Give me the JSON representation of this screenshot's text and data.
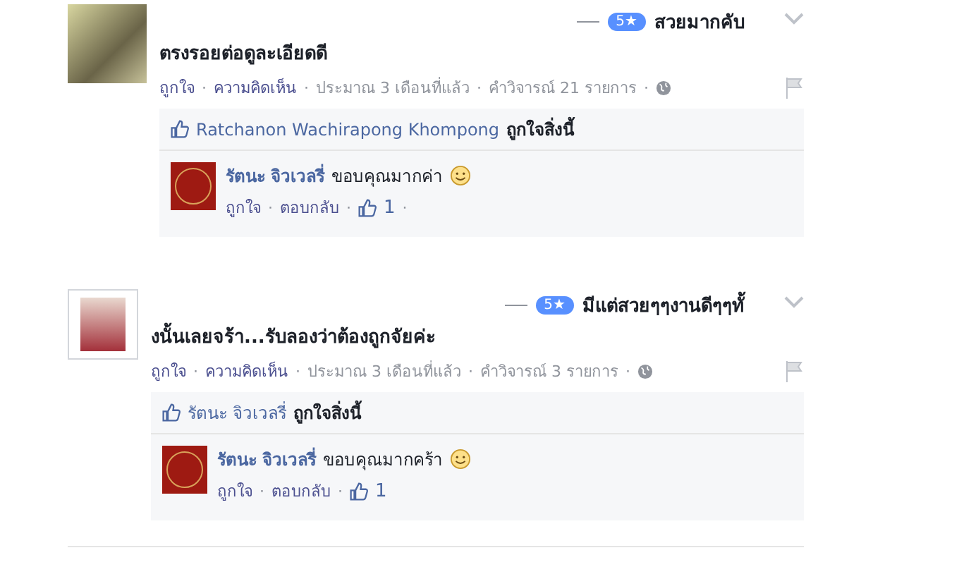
{
  "reviews": [
    {
      "avatar_framed": false,
      "rating": "5★",
      "text_line_1": "สวยมากคับ",
      "text_line_2": "ตรงรอยต่อดูละเอียดดี",
      "meta": [
        {
          "kind": "link",
          "text": "ถูกใจ"
        },
        {
          "kind": "dot",
          "text": "·"
        },
        {
          "kind": "link",
          "text": "ความคิดเห็น"
        },
        {
          "kind": "dot",
          "text": "·"
        },
        {
          "kind": "plain",
          "text": "ประมาณ 3 เดือนที่แล้ว"
        },
        {
          "kind": "dot",
          "text": "·"
        },
        {
          "kind": "plain",
          "text": "คำวิจารณ์ 21 รายการ"
        },
        {
          "kind": "dot",
          "text": "·"
        }
      ],
      "likes": {
        "name": "Ratchanon Wachirapong Khompong",
        "suffix": "ถูกใจสิ่งนี้"
      },
      "reply": {
        "name": "รัตนะ จิวเวลรี่",
        "text": "ขอบคุณมากค่า",
        "actions": [
          {
            "kind": "link",
            "text": "ถูกใจ"
          },
          {
            "kind": "dot",
            "text": "·"
          },
          {
            "kind": "link",
            "text": "ตอบกลับ"
          },
          {
            "kind": "dot",
            "text": "·"
          },
          {
            "kind": "likes",
            "text": "1"
          },
          {
            "kind": "dot",
            "text": "·"
          }
        ]
      }
    },
    {
      "avatar_framed": true,
      "rating": "5★",
      "text_line_1": "มีแต่สวยๆๆงานดีๆๆทั้",
      "text_line_2": "งนั้นเลยจร้า...รับลองว่าต้องถูกจัยค่ะ",
      "meta": [
        {
          "kind": "link",
          "text": "ถูกใจ"
        },
        {
          "kind": "dot",
          "text": "·"
        },
        {
          "kind": "link",
          "text": "ความคิดเห็น"
        },
        {
          "kind": "dot",
          "text": "·"
        },
        {
          "kind": "plain",
          "text": "ประมาณ 3 เดือนที่แล้ว"
        },
        {
          "kind": "dot",
          "text": "·"
        },
        {
          "kind": "plain",
          "text": "คำวิจารณ์ 3 รายการ"
        },
        {
          "kind": "dot",
          "text": "·"
        }
      ],
      "likes": {
        "name": "รัตนะ จิวเวลรี่",
        "suffix": "ถูกใจสิ่งนี้"
      },
      "reply": {
        "name": "รัตนะ จิวเวลรี่",
        "text": "ขอบคุณมากคร้า",
        "actions": [
          {
            "kind": "link",
            "text": "ถูกใจ"
          },
          {
            "kind": "dot",
            "text": "·"
          },
          {
            "kind": "link",
            "text": "ตอบกลับ"
          },
          {
            "kind": "dot",
            "text": "·"
          },
          {
            "kind": "likes",
            "text": "1"
          }
        ]
      }
    }
  ]
}
